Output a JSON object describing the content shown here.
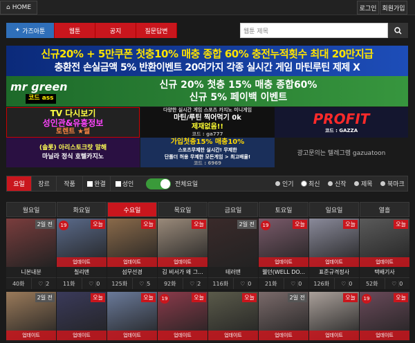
{
  "topbar": {
    "home": "HOME",
    "login": "로그인",
    "signup": "회원가입"
  },
  "nav": {
    "items": [
      "가즈아툰",
      "웹툰",
      "공지",
      "질문답변"
    ],
    "search_placeholder": "웹툰 제목"
  },
  "banners": {
    "b1_line1": "신규20% + 5만쿠폰 첫충10% 매충 종합 60% 충전누적횟수 최대 20만지급",
    "b1_line2": "충환전 손실금액 5% 반환이벤트 20여가지 각종 실시간 게임 마틴루틴 제제 X",
    "b2_logo": "mr green",
    "b2_code": "코드 ass",
    "b2_line1": "신규 20% 첫충 15% 매충 종합60%",
    "b2_line2": "신규 5% 페이백 이벤트",
    "tv_l1": "TV 다시보기",
    "tv_l2": "성인관&유흥정보",
    "tv_l3": "토렌트 ★썰",
    "id_l1": "다양한 실시간 게임 스포츠 카지노 미니게임",
    "id_l2": "마틴/루틴 찍어먹기 0k",
    "id_l3": "제재없음!!",
    "id_code": "코드 : ga777",
    "profit": "PROFIT",
    "profit_sub": "코드 : GAZZA",
    "arisu_l1": "(솔롯) 아리스토크랏 말해",
    "arisu_l2": "마닐라 정식 호텔카지노",
    "fk_l1": "가입첫충15% 매충10%",
    "fk_l2": "스포츠무제한 실시간! 무제한",
    "fk_l3": "단폴더 허용 무제한 모든게임 > 최고배율!",
    "fk_code": "코드 : 6969",
    "ad": "광고문의는 텔레그램 gazuatoon"
  },
  "filter": {
    "tabs": [
      "요일",
      "장르",
      "작품"
    ],
    "checks": [
      "완결",
      "성인"
    ],
    "toggle_label": "전체요일",
    "sorts": [
      "인기",
      "최신",
      "신작",
      "제목",
      "북마크"
    ],
    "active_sort": "최신"
  },
  "days": [
    "월요일",
    "화요일",
    "수요일",
    "목요일",
    "금요일",
    "토요일",
    "일요일",
    "열흘"
  ],
  "active_day": "수요일",
  "row1": [
    {
      "badge": "2일 전",
      "badge_type": "gray",
      "age": "",
      "update": "",
      "title": "니본내분",
      "views": "40화",
      "likes": "2"
    },
    {
      "badge": "오늘",
      "badge_type": "red",
      "age": "19",
      "update": "업데이트",
      "title": "칠리맨",
      "views": "11화",
      "likes": "0"
    },
    {
      "badge": "오늘",
      "badge_type": "red",
      "age": "",
      "update": "업데이트",
      "title": "섬무선경",
      "views": "125화",
      "likes": "5"
    },
    {
      "badge": "오늘",
      "badge_type": "red",
      "age": "",
      "update": "업데이트",
      "title": "김 비서가 왜 그...",
      "views": "92화",
      "likes": "2"
    },
    {
      "badge": "2일 전",
      "badge_type": "gray",
      "age": "",
      "update": "",
      "title": "테러맨",
      "views": "116화",
      "likes": "0"
    },
    {
      "badge": "오늘",
      "badge_type": "red",
      "age": "19",
      "update": "업데이트",
      "title": "웰던(WELL DO...",
      "views": "21화",
      "likes": "0"
    },
    {
      "badge": "오늘",
      "badge_type": "red",
      "age": "",
      "update": "업데이트",
      "title": "표준규격정사",
      "views": "126화",
      "likes": "0"
    },
    {
      "badge": "오늘",
      "badge_type": "red",
      "age": "",
      "update": "업데이트",
      "title": "택배기사",
      "views": "52화",
      "likes": "0"
    }
  ],
  "row2": [
    {
      "badge": "2일 전",
      "badge_type": "gray",
      "age": "",
      "update": "업데이트"
    },
    {
      "badge": "오늘",
      "badge_type": "red",
      "age": "",
      "update": "업데이트"
    },
    {
      "badge": "오늘",
      "badge_type": "red",
      "age": "",
      "update": "업데이트"
    },
    {
      "badge": "오늘",
      "badge_type": "red",
      "age": "19",
      "update": "업데이트"
    },
    {
      "badge": "오늘",
      "badge_type": "red",
      "age": "",
      "update": "업데이트"
    },
    {
      "badge": "2일 전",
      "badge_type": "gray",
      "age": "",
      "update": "업데이트"
    },
    {
      "badge": "오늘",
      "badge_type": "red",
      "age": "",
      "update": "업데이트"
    },
    {
      "badge": "오늘",
      "badge_type": "red",
      "age": "19",
      "update": "업데이트"
    }
  ],
  "thumb_colors": [
    "#7a3d3d",
    "#5a6a8a",
    "#8a6a4a",
    "#9a8a7a",
    "#3a2a2a",
    "#7a5a6a",
    "#8a8a9a",
    "#5a5a5a"
  ],
  "thumb_colors2": [
    "#9a7a5a",
    "#3a3a5a",
    "#6a7a9a",
    "#8a3a4a",
    "#5a5a4a",
    "#7a6a6a",
    "#aaa09a",
    "#6a4a5a"
  ]
}
